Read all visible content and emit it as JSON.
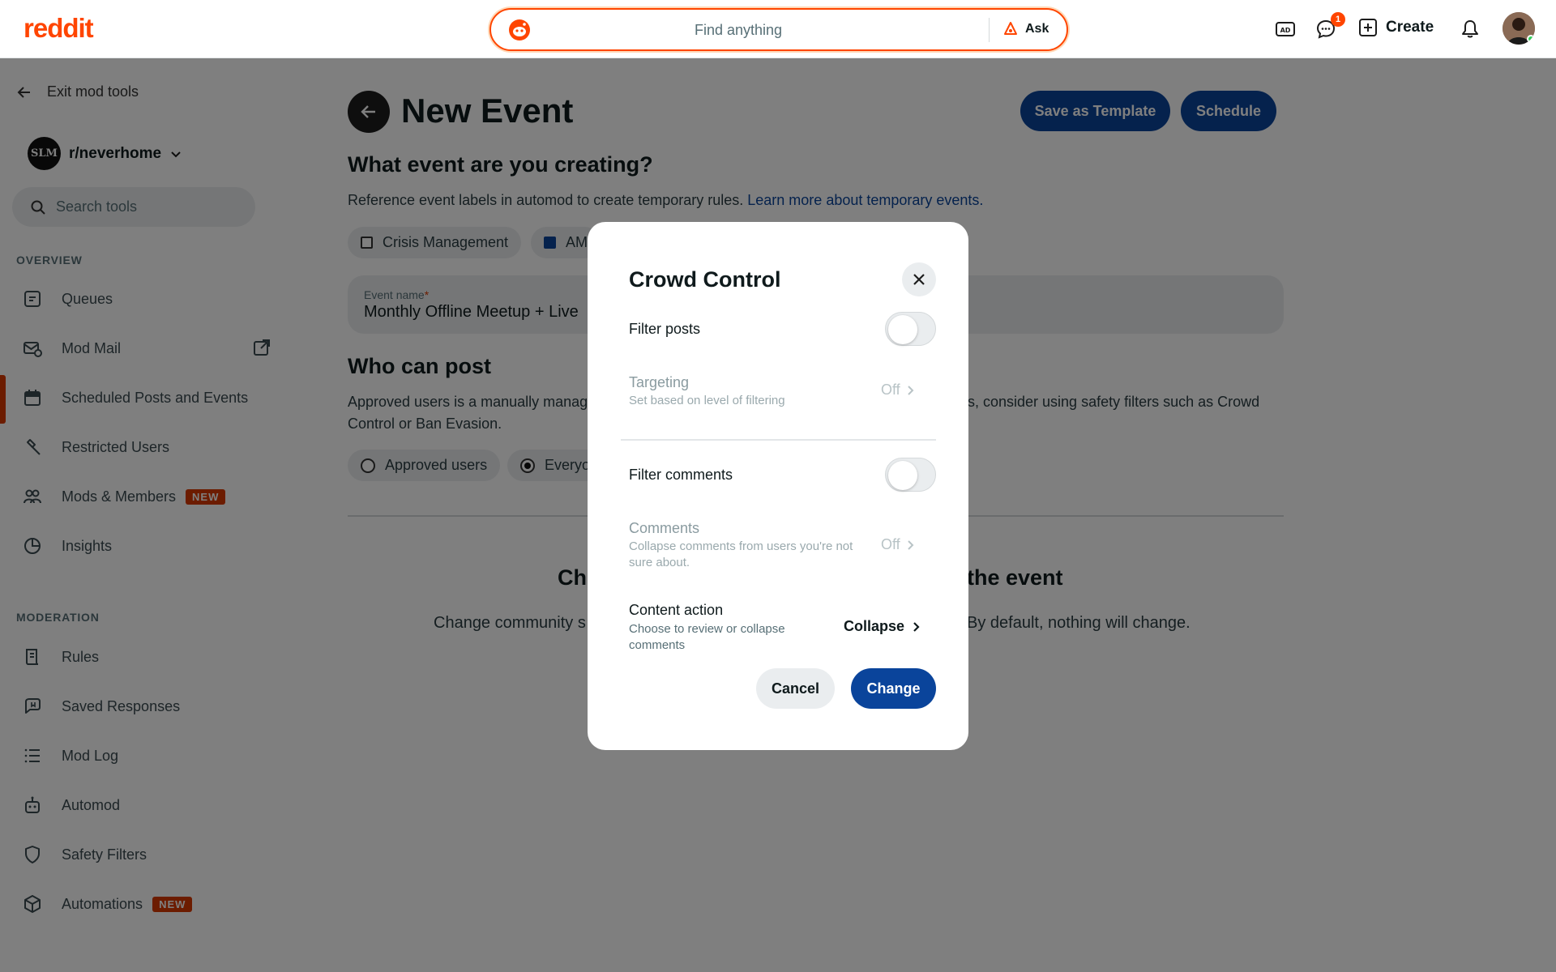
{
  "header": {
    "logo": "reddit",
    "search_placeholder": "Find anything",
    "ask_label": "Ask",
    "chat_badge": "1",
    "create_label": "Create"
  },
  "sidebar": {
    "exit_label": "Exit mod tools",
    "subreddit": "r/neverhome",
    "subreddit_avatar_text": "SLM",
    "search_placeholder": "Search tools",
    "overview_label": "OVERVIEW",
    "overview_items": [
      {
        "label": "Queues",
        "icon": "queue-icon"
      },
      {
        "label": "Mod Mail",
        "icon": "mail-icon"
      },
      {
        "label": "Scheduled Posts and Events",
        "icon": "calendar-icon",
        "active": true
      },
      {
        "label": "Restricted Users",
        "icon": "hammer-icon"
      },
      {
        "label": "Mods & Members",
        "icon": "members-icon",
        "tag": "NEW"
      },
      {
        "label": "Insights",
        "icon": "chart-icon"
      }
    ],
    "moderation_label": "MODERATION",
    "moderation_items": [
      {
        "label": "Rules",
        "icon": "rules-icon"
      },
      {
        "label": "Saved Responses",
        "icon": "saved-response-icon"
      },
      {
        "label": "Mod Log",
        "icon": "list-icon"
      },
      {
        "label": "Automod",
        "icon": "robot-icon"
      },
      {
        "label": "Safety Filters",
        "icon": "shield-icon"
      },
      {
        "label": "Automations",
        "icon": "cube-icon",
        "tag": "NEW"
      }
    ]
  },
  "main": {
    "title": "New Event",
    "save_template_label": "Save as Template",
    "schedule_label": "Schedule",
    "event_heading": "What event are you creating?",
    "event_desc": "Reference event labels in automod to create temporary rules. ",
    "event_link": "Learn more about temporary events.",
    "chips": [
      {
        "label": "Crisis Management",
        "checked": false
      },
      {
        "label": "AM",
        "checked": true
      }
    ],
    "event_name_label": "Event name",
    "event_name_value": "Monthly Offline Meetup + Live",
    "who_heading": "Who can post",
    "who_desc_line1_left": "Approved users is a manually manag",
    "who_desc_line1_right": "rs, consider using safety filters such as Crowd",
    "who_desc_line2": "Control or Ban Evasion.",
    "radios": [
      {
        "label": "Approved users",
        "selected": false
      },
      {
        "label": "Everyo",
        "selected": true
      }
    ],
    "change_heading_left": "Ch",
    "change_heading_right": "the event",
    "change_desc_left": "Change community s",
    "change_desc_right": "By default, nothing will change."
  },
  "modal": {
    "title": "Crowd Control",
    "filter_posts_label": "Filter posts",
    "filter_posts_on": false,
    "targeting_label": "Targeting",
    "targeting_desc": "Set based on level of filtering",
    "targeting_value": "Off",
    "filter_comments_label": "Filter comments",
    "filter_comments_on": false,
    "comments_label": "Comments",
    "comments_desc": "Collapse comments from users you're not sure about.",
    "comments_value": "Off",
    "content_action_label": "Content action",
    "content_action_desc": "Choose to review or collapse comments",
    "content_action_value": "Collapse",
    "cancel_label": "Cancel",
    "change_label": "Change"
  },
  "colors": {
    "brand": "#ff4500",
    "primary_button": "#0a449b",
    "new_tag": "#d93900"
  }
}
